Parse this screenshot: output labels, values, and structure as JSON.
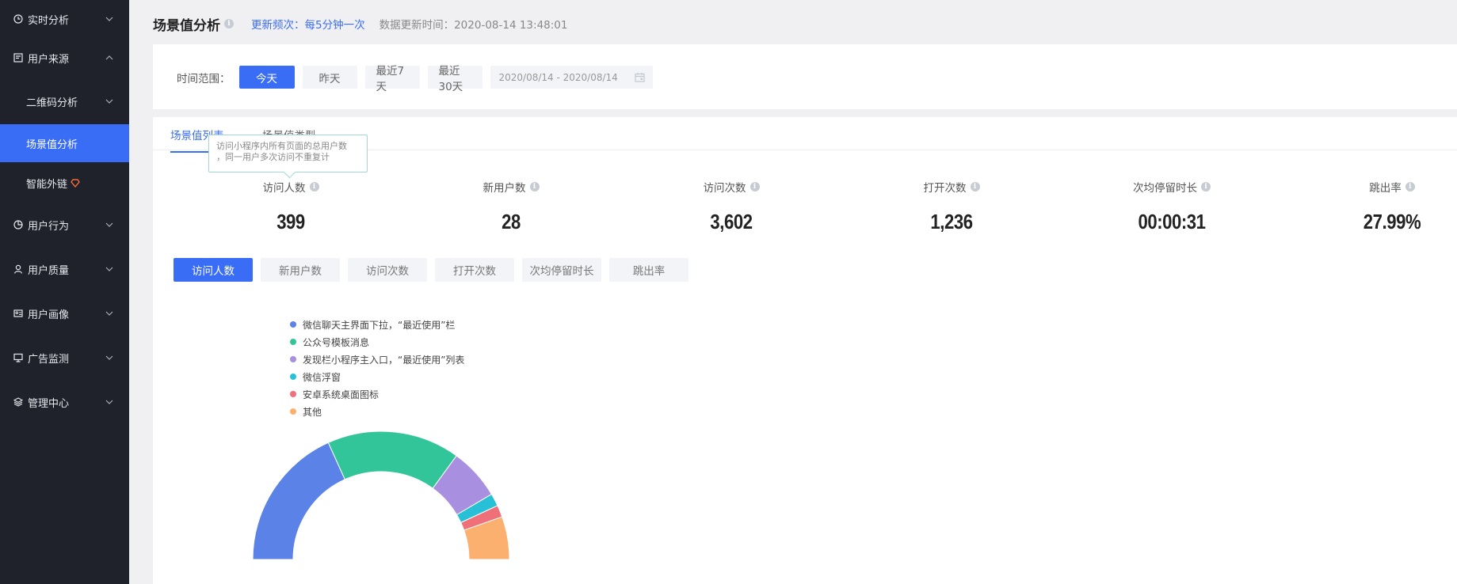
{
  "sidebar": {
    "items": [
      {
        "label": "实时分析",
        "icon": "clock-icon"
      },
      {
        "label": "用户来源",
        "icon": "report-icon"
      },
      {
        "label": "二维码分析",
        "icon": ""
      },
      {
        "label": "场景值分析",
        "icon": ""
      },
      {
        "label": "智能外链",
        "icon": "diamond-icon"
      },
      {
        "label": "用户行为",
        "icon": "pie-icon"
      },
      {
        "label": "用户质量",
        "icon": "user-icon"
      },
      {
        "label": "用户画像",
        "icon": "profile-icon"
      },
      {
        "label": "广告监测",
        "icon": "monitor-icon"
      },
      {
        "label": "管理中心",
        "icon": "layers-icon"
      }
    ]
  },
  "header": {
    "title": "场景值分析",
    "freq": "更新频次：每5分钟一次",
    "updated": "数据更新时间：2020-08-14 13:48:01"
  },
  "filter": {
    "label": "时间范围：",
    "buttons": [
      "今天",
      "昨天",
      "最近7天",
      "最近30天"
    ],
    "date_range": "2020/08/14 - 2020/08/14"
  },
  "tabs": [
    "场景值列表",
    "场景值类型"
  ],
  "tooltip": {
    "line1": "访问小程序内所有页面的总用户数",
    "line2": "，同一用户多次访问不重复计"
  },
  "metrics": [
    {
      "label": "访问人数",
      "value": "399"
    },
    {
      "label": "新用户数",
      "value": "28"
    },
    {
      "label": "访问次数",
      "value": "3,602"
    },
    {
      "label": "打开次数",
      "value": "1,236"
    },
    {
      "label": "次均停留时长",
      "value": "00:00:31"
    },
    {
      "label": "跳出率",
      "value": "27.99%"
    }
  ],
  "metric_buttons": [
    "访问人数",
    "新用户数",
    "访问次数",
    "打开次数",
    "次均停留时长",
    "跳出率"
  ],
  "colors": {
    "accent": "#3a6df6",
    "sidebar_bg": "#1f222b"
  },
  "chart_data": {
    "type": "pie",
    "labels": [
      "微信聊天主界面下拉，“最近使用”栏",
      "公众号模板消息",
      "发现栏小程序主入口，“最近使用”列表",
      "微信浮窗",
      "安卓系统桌面图标",
      "其他"
    ],
    "values": [
      36.5,
      33.5,
      13.0,
      3.2,
      3.0,
      10.8
    ],
    "colors": [
      "#5b82e6",
      "#33c59a",
      "#a98fe0",
      "#27c0d6",
      "#f0707a",
      "#fbb06f"
    ],
    "style": "half-donut"
  }
}
